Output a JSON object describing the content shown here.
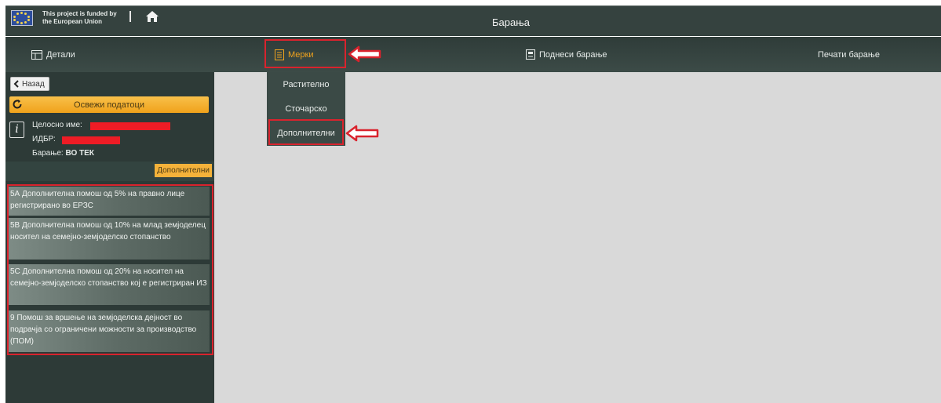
{
  "topbar": {
    "eu_text_line1": "This project is funded by",
    "eu_text_line2": "the European Union",
    "title": "Барања",
    "icons": [
      "eu-flag-icon",
      "home-icon"
    ]
  },
  "nav": {
    "details": "Детали",
    "measures": "Мерки",
    "submit": "Поднеси барање",
    "print": "Печати барање"
  },
  "dropdown": [
    "Растително",
    "Сточарско",
    "Дополнителни"
  ],
  "sidebar": {
    "back": "Назад",
    "refresh": "Освежи податоци",
    "full_name_label": "Целосно име:",
    "id_label": "ИДБР:",
    "request_label": "Барање:",
    "request_status": "ВО ТЕК",
    "category_tag": "Дополнителни",
    "measures": [
      "5А Дополнителна помош од 5% на правно лице регистрирано во ЕРЗС",
      "5В Дополнителна помош од 10% на млад земјоделец носител на семејно-земјоделско стопанство",
      "5С Дополнителна помош од 20% на носител на семејно-земјоделско стопанство кој е регистриран ИЗ",
      "9 Помош за вршење на земјоделска дејност во подрачја со ограничени можности за производство (ПОМ)"
    ]
  },
  "colors": {
    "accent": "#f0a31d",
    "highlight": "#d9232d",
    "redaction": "#ee1c25",
    "dark_bg": "#2d3a37"
  }
}
